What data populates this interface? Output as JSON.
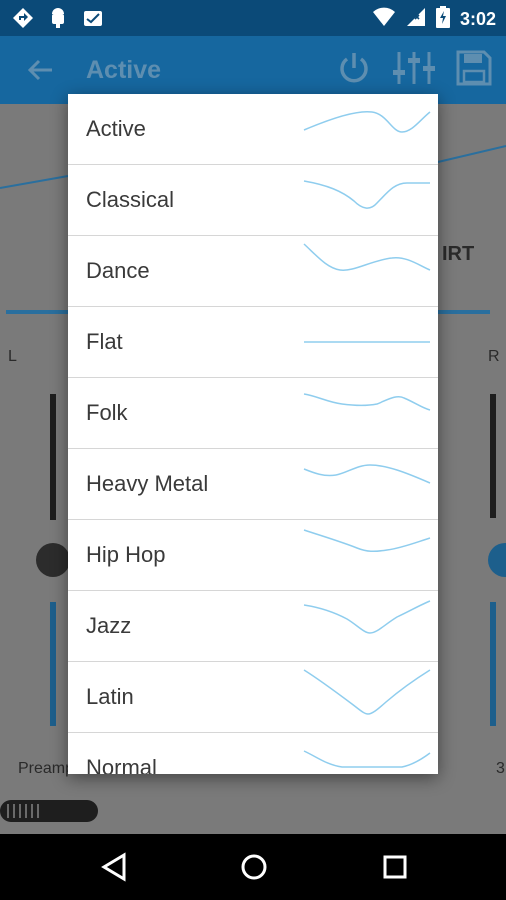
{
  "status_bar": {
    "time": "3:02",
    "icons_left": [
      "navigation-icon",
      "android-icon",
      "inbox-icon"
    ],
    "icons_right": [
      "wifi-icon",
      "signal-icon",
      "battery-icon"
    ]
  },
  "app_bar": {
    "title": "Active",
    "icons": [
      "back-arrow-icon",
      "power-icon",
      "equalizer-sliders-icon",
      "save-icon"
    ]
  },
  "background": {
    "left_channel": "L",
    "right_channel": "R",
    "preamp_label": "Preamp",
    "right_edge_value": "3"
  },
  "preset_list": {
    "items": [
      {
        "label": "Active"
      },
      {
        "label": "Classical"
      },
      {
        "label": "Dance"
      },
      {
        "label": "Flat"
      },
      {
        "label": "Folk"
      },
      {
        "label": "Heavy Metal"
      },
      {
        "label": "Hip Hop"
      },
      {
        "label": "Jazz"
      },
      {
        "label": "Latin"
      },
      {
        "label": "Normal"
      }
    ]
  },
  "colors": {
    "statusbar_bg": "#0b4a78",
    "appbar_bg": "#16679f",
    "curve": "#8fcdee",
    "accent": "#2a8ccf"
  },
  "navigation_bar": {
    "icons": [
      "back-triangle-icon",
      "home-circle-icon",
      "recents-square-icon"
    ]
  }
}
